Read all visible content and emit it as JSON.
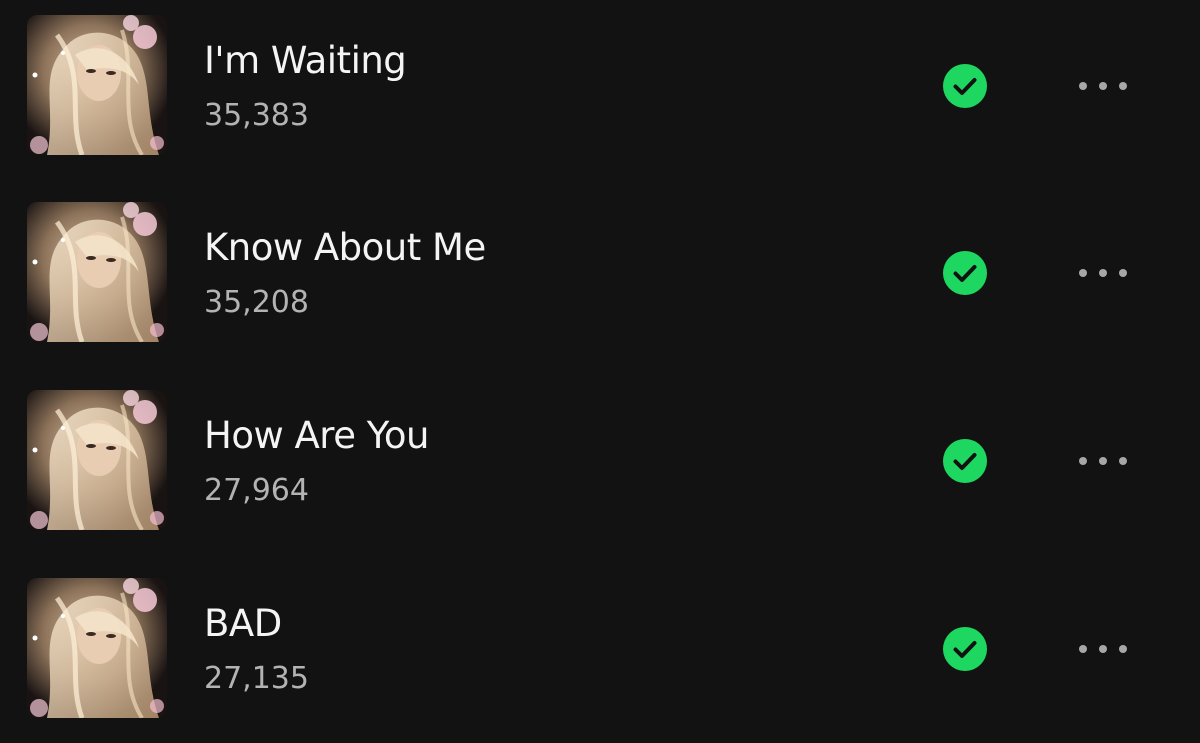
{
  "colors": {
    "background": "#121212",
    "title": "#f4f4f4",
    "subtitle": "#b3b3b3",
    "downloaded_green": "#1ed760",
    "more_dots": "#a7a7a7"
  },
  "icons": {
    "downloaded": "downloaded-check-icon",
    "more": "more-options-icon"
  },
  "tracks": [
    {
      "title": "I'm Waiting",
      "plays": "35,383",
      "downloaded": true
    },
    {
      "title": "Know About Me",
      "plays": "35,208",
      "downloaded": true
    },
    {
      "title": "How Are You",
      "plays": "27,964",
      "downloaded": true
    },
    {
      "title": "BAD",
      "plays": "27,135",
      "downloaded": true
    }
  ]
}
